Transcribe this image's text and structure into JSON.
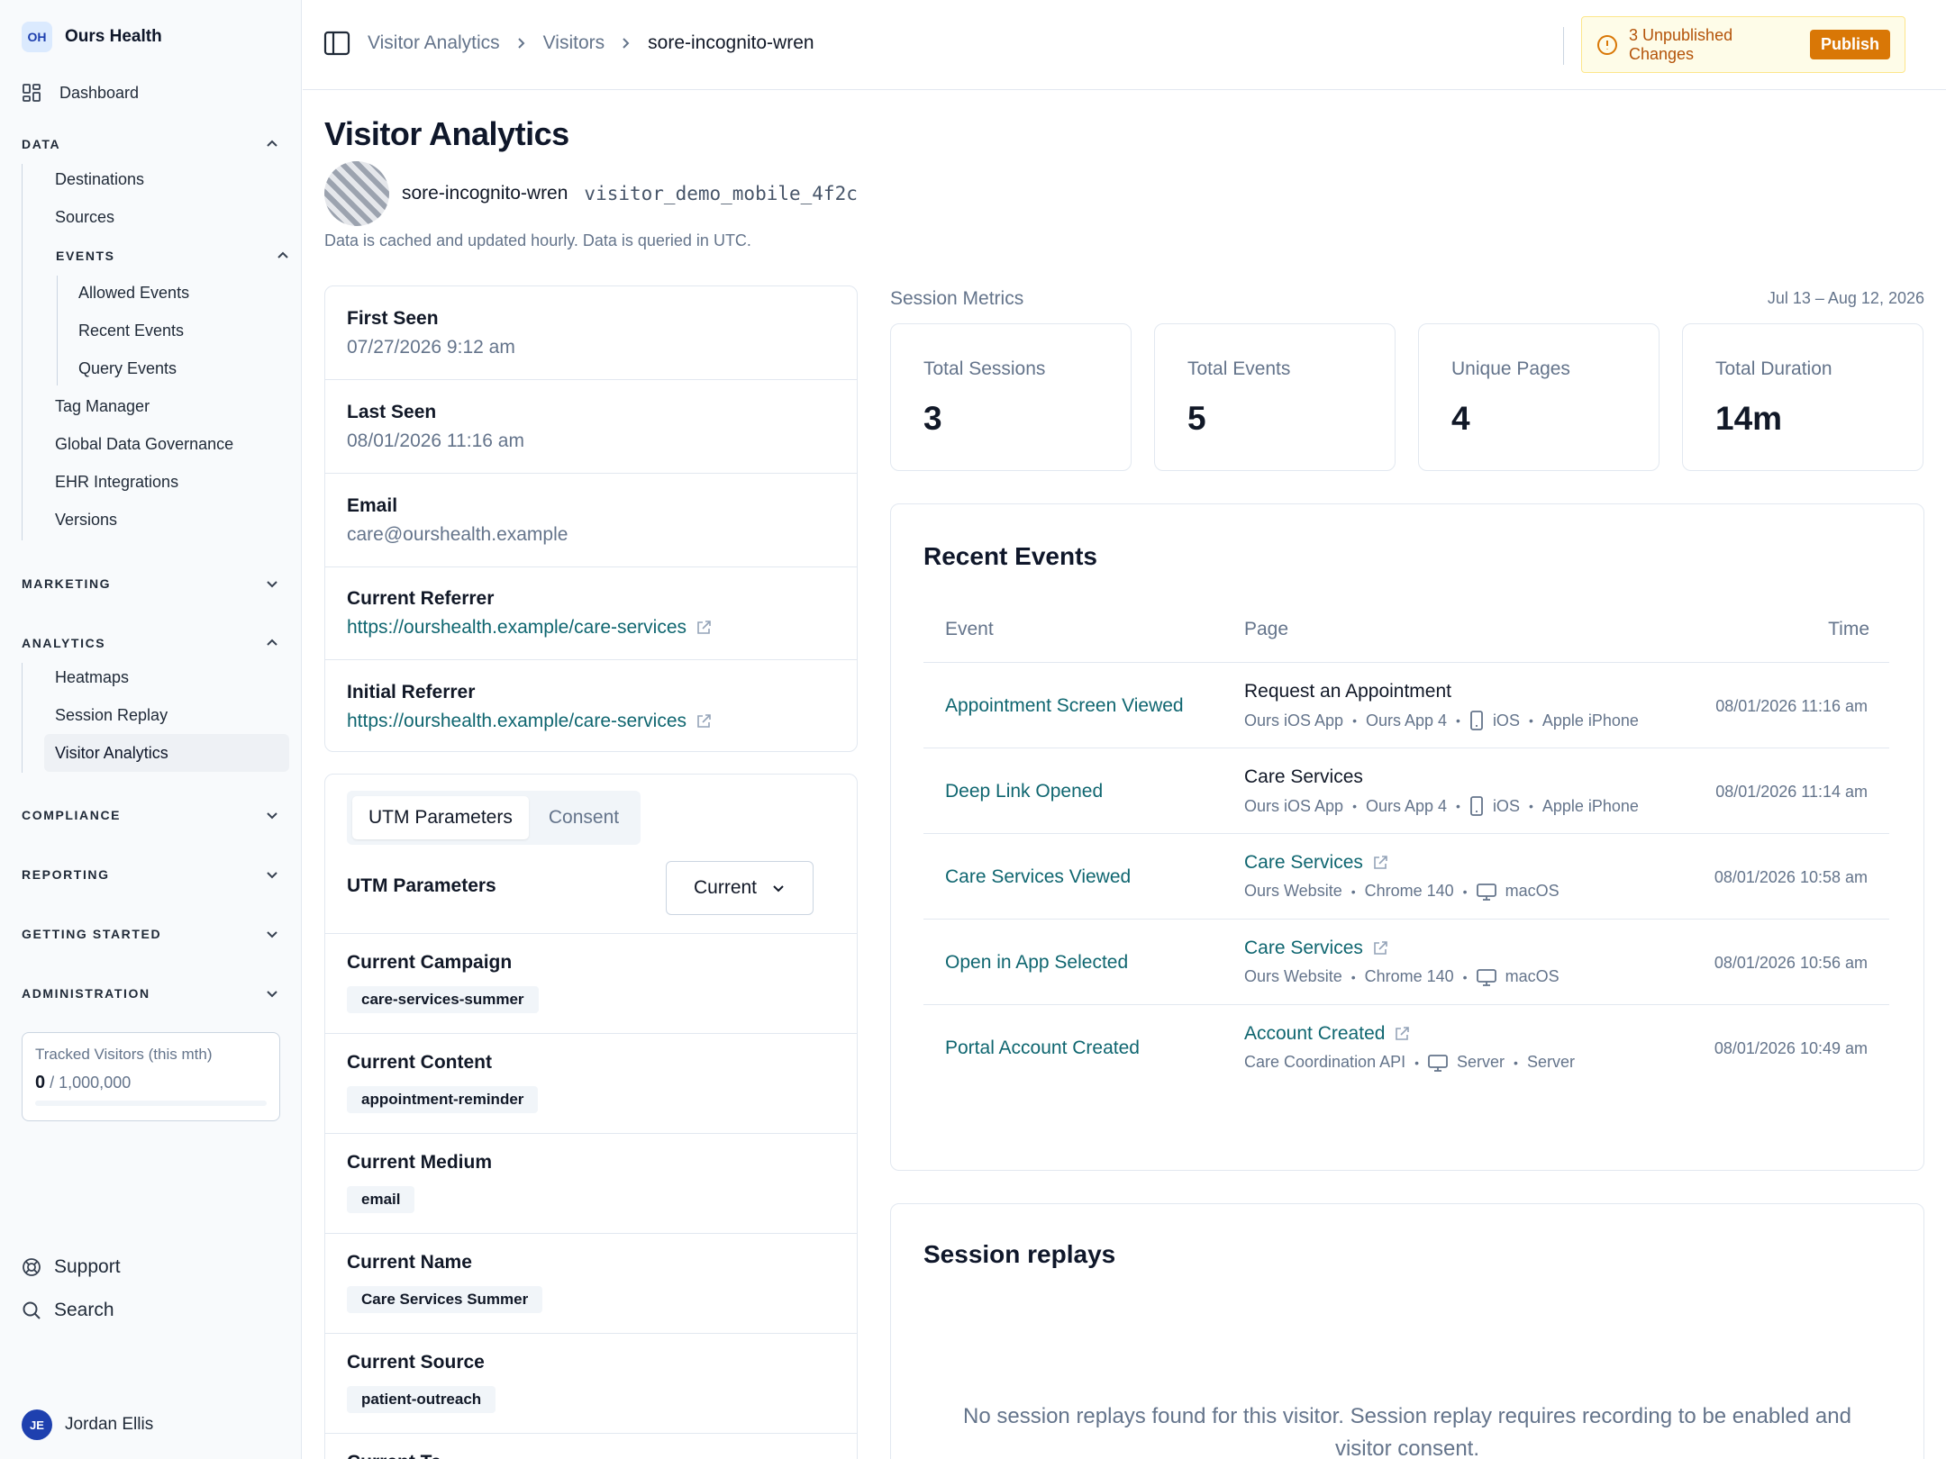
{
  "org": {
    "initials": "OH",
    "name": "Ours Health"
  },
  "sidebar": {
    "dashboard": "Dashboard",
    "data": {
      "label": "DATA",
      "items": [
        "Destinations",
        "Sources"
      ],
      "events": {
        "label": "EVENTS",
        "items": [
          "Allowed Events",
          "Recent Events",
          "Query Events"
        ]
      },
      "more": [
        "Tag Manager",
        "Global Data Governance",
        "EHR Integrations",
        "Versions"
      ]
    },
    "marketing": "MARKETING",
    "analytics": {
      "label": "ANALYTICS",
      "items": [
        "Heatmaps",
        "Session Replay",
        "Visitor Analytics"
      ]
    },
    "compliance": "COMPLIANCE",
    "reporting": "REPORTING",
    "getting_started": "GETTING STARTED",
    "administration": "ADMINISTRATION",
    "quota": {
      "label": "Tracked Visitors (this mth)",
      "used": "0",
      "limit": "/ 1,000,000",
      "fraction": 0
    },
    "support": "Support",
    "search": "Search",
    "user": {
      "initials": "JE",
      "name": "Jordan Ellis"
    }
  },
  "breadcrumb": [
    "Visitor Analytics",
    "Visitors",
    "sore-incognito-wren"
  ],
  "changes": {
    "text": "3 Unpublished Changes",
    "publish": "Publish"
  },
  "page": {
    "title": "Visitor Analytics",
    "visitor_name": "sore-incognito-wren",
    "visitor_id": "visitor_demo_mobile_4f2c",
    "note": "Data is cached and updated hourly. Data is queried in UTC."
  },
  "profile": [
    {
      "label": "First Seen",
      "value": "07/27/2026 9:12 am"
    },
    {
      "label": "Last Seen",
      "value": "08/01/2026 11:16 am"
    },
    {
      "label": "Email",
      "value": "care@ourshealth.example"
    },
    {
      "label": "Current Referrer",
      "value": "https://ourshealth.example/care-services"
    },
    {
      "label": "Initial Referrer",
      "value": "https://ourshealth.example/care-services"
    }
  ],
  "utm": {
    "tabs": [
      "UTM Parameters",
      "Consent"
    ],
    "heading": "UTM Parameters",
    "dropdown": "Current",
    "rows": [
      {
        "label": "Current Campaign",
        "value": "care-services-summer"
      },
      {
        "label": "Current Content",
        "value": "appointment-reminder"
      },
      {
        "label": "Current Medium",
        "value": "email"
      },
      {
        "label": "Current Name",
        "value": "Care Services Summer"
      },
      {
        "label": "Current Source",
        "value": "patient-outreach"
      },
      {
        "label": "Current Te",
        "value": ""
      }
    ]
  },
  "metrics": {
    "heading": "Session Metrics",
    "date_range": "Jul 13 – Aug 12, 2026",
    "cards": [
      {
        "label": "Total Sessions",
        "value": "3"
      },
      {
        "label": "Total Events",
        "value": "5"
      },
      {
        "label": "Unique Pages",
        "value": "4"
      },
      {
        "label": "Total Duration",
        "value": "14m"
      }
    ]
  },
  "recent_events": {
    "title": "Recent Events",
    "columns": [
      "Event",
      "Page",
      "Time"
    ],
    "rows": [
      {
        "event": "Appointment Screen Viewed",
        "page": "Request an Appointment",
        "app": "Ours iOS App",
        "version": "Ours App 4",
        "os": "iOS",
        "device": "Apple iPhone",
        "time": "08/01/2026 11:16 am"
      },
      {
        "event": "Deep Link Opened",
        "page": "Care Services",
        "app": "Ours iOS App",
        "version": "Ours App 4",
        "os": "iOS",
        "device": "Apple iPhone",
        "time": "08/01/2026 11:14 am"
      },
      {
        "event": "Care Services Viewed",
        "page": "Care Services",
        "app": "Ours Website",
        "version": "Chrome 140",
        "os": "macOS",
        "device": "",
        "time": "08/01/2026 10:58 am"
      },
      {
        "event": "Open in App Selected",
        "page": "Care Services",
        "app": "Ours Website",
        "version": "Chrome 140",
        "os": "macOS",
        "device": "",
        "time": "08/01/2026 10:56 am"
      },
      {
        "event": "Portal Account Created",
        "page": "Account Created",
        "app": "Care Coordination API",
        "version": "",
        "os": "Server",
        "device": "Server",
        "time": "08/01/2026 10:49 am"
      }
    ]
  },
  "session_replays": {
    "title": "Session replays",
    "empty": "No session replays found for this visitor. Session replay requires recording to be enabled and visitor consent."
  }
}
